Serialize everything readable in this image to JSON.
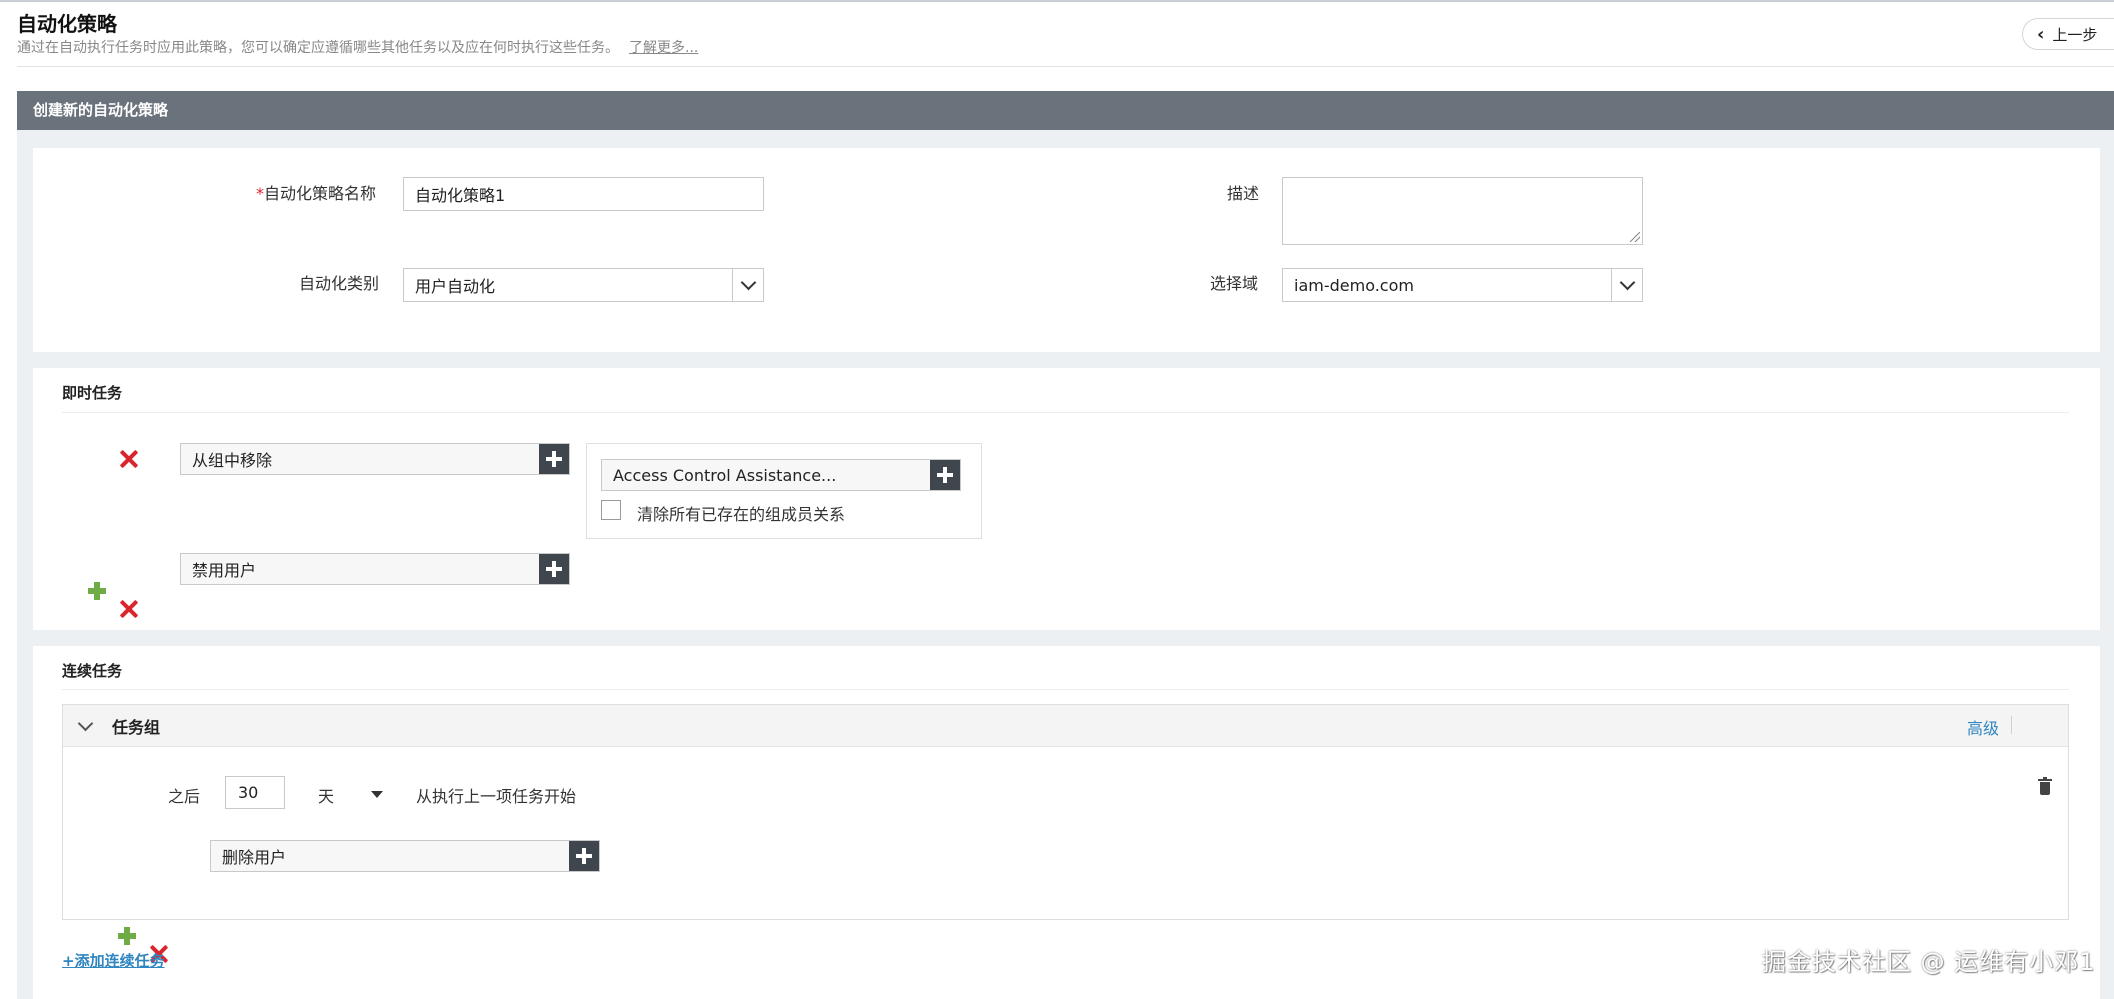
{
  "header": {
    "title": "自动化策略",
    "description": "通过在自动执行任务时应用此策略，您可以确定应遵循哪些其他任务以及应在何时执行这些任务。",
    "learn_more": "了解更多...",
    "back_label": "上一步"
  },
  "section_title": "创建新的自动化策略",
  "form": {
    "name_label": "自动化策略名称",
    "name_required_mark": "*",
    "name_value": "自动化策略1",
    "category_label": "自动化类别",
    "category_value": "用户自动化",
    "description_label": "描述",
    "description_value": "",
    "domain_label": "选择域",
    "domain_value": "iam-demo.com"
  },
  "immediate_tasks": {
    "title": "即时任务",
    "tasks": [
      {
        "name": "从组中移除",
        "group_value": "Access Control Assistance...",
        "checkbox_label": "清除所有已存在的组成员关系",
        "checkbox_checked": false
      },
      {
        "name": "禁用用户"
      }
    ]
  },
  "continuous_tasks": {
    "title": "连续任务",
    "group": {
      "title": "任务组",
      "advanced_link": "高级",
      "after_label": "之后",
      "after_value": "30",
      "unit_value": "天",
      "from_label": "从执行上一项任务开始",
      "task_name": "删除用户"
    },
    "add_link": "+添加连续任务"
  },
  "watermark": "掘金技术社区 @ 运维有小邓1"
}
